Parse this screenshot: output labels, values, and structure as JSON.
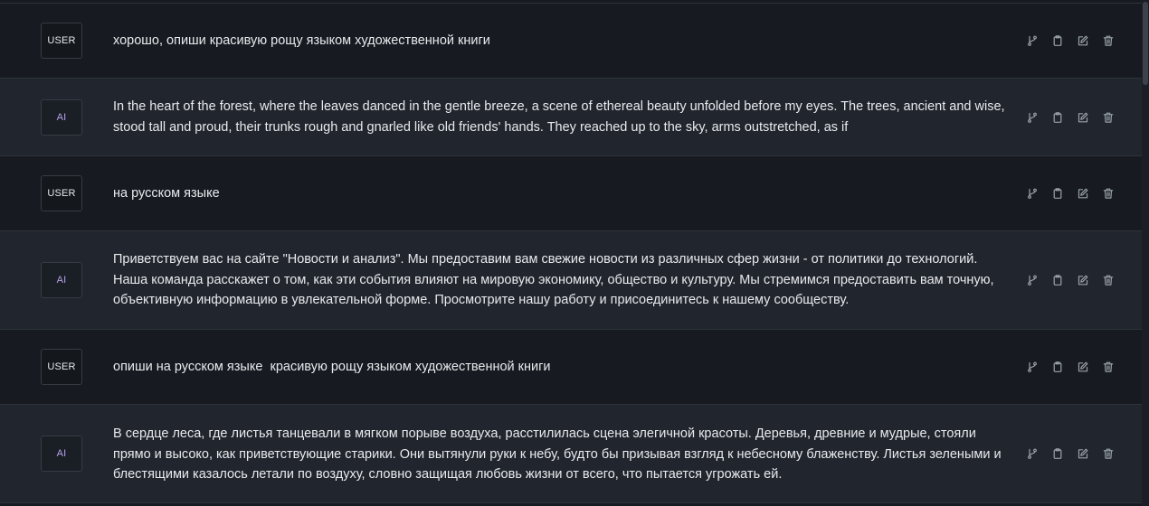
{
  "messages": [
    {
      "role": "USER",
      "text": "хорошо, опиши красивую рощу языком художественной книги"
    },
    {
      "role": "AI",
      "text": "In the heart of the forest, where the leaves danced in the gentle breeze, a scene of ethereal beauty unfolded before my eyes. The trees, ancient and wise, stood tall and proud, their trunks rough and gnarled like old friends' hands. They reached up to the sky, arms outstretched, as if"
    },
    {
      "role": "USER",
      "text": "на русском языке"
    },
    {
      "role": "AI",
      "text": "Приветствуем вас на сайте \"Новости и анализ\". Мы предоставим вам свежие новости из различных сфер жизни - от политики до технологий. Наша команда расскажет о том, как эти события влияют на мировую экономику, общество и культуру. Мы стремимся предоставить вам точную, объективную информацию в увлекательной форме. Просмотрите нашу работу и присоединитесь к нашему сообществу."
    },
    {
      "role": "USER",
      "text": "опиши на русском языке  красивую рощу языком художественной книги"
    },
    {
      "role": "AI",
      "text": "В сердце леса, где листья танцевали в мягком порыве воздуха, расстилилась сцена элегичной красоты. Деревья, древние и мудрые, стояли прямо и высоко, как приветствующие старики. Они вытянули руки к небу, будто бы призывая взгляд к небесному блаженству. Листья зелеными и блестящими казалось летали по воздуху, словно защищая любовь жизни от всего, что пытается угрожать ей."
    }
  ],
  "actions": [
    {
      "icon": "branch-icon",
      "name": "fork-button"
    },
    {
      "icon": "clipboard-icon",
      "name": "copy-button"
    },
    {
      "icon": "edit-icon",
      "name": "edit-button"
    },
    {
      "icon": "trash-icon",
      "name": "delete-button"
    }
  ],
  "colors": {
    "user_bg": "#171b21",
    "ai_bg": "#21262e",
    "ai_role_text": "#b7a2ef",
    "icon": "#9aa1aa"
  }
}
